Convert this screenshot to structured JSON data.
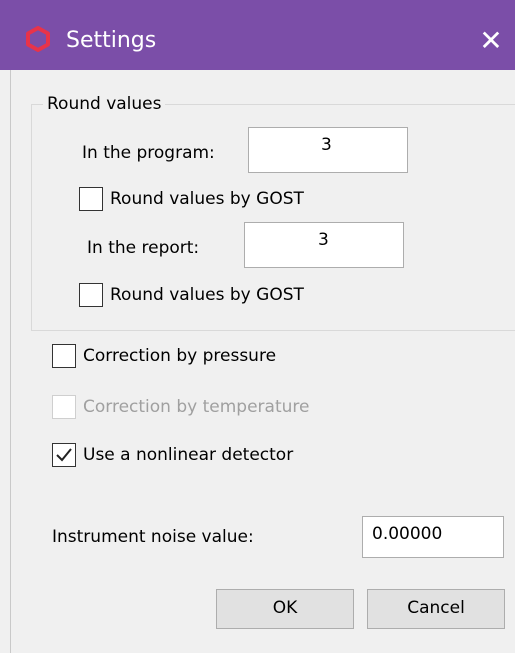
{
  "window": {
    "title": "Settings",
    "close_glyph": "✕"
  },
  "round_group": {
    "label": "Round values",
    "program": {
      "label": "In the program:",
      "value": "3",
      "gost_label": "Round values by GOST",
      "gost_checked": false
    },
    "report": {
      "label": "In the report:",
      "value": "3",
      "gost_label": "Round values by GOST",
      "gost_checked": false
    }
  },
  "options": {
    "pressure": {
      "label": "Correction by pressure",
      "checked": false,
      "enabled": true
    },
    "temperature": {
      "label": "Correction by temperature",
      "checked": false,
      "enabled": false
    },
    "nonlinear": {
      "label": "Use a nonlinear detector",
      "checked": true,
      "enabled": true
    }
  },
  "noise": {
    "label": "Instrument noise value:",
    "value": "0.00000"
  },
  "buttons": {
    "ok": "OK",
    "cancel": "Cancel"
  },
  "colors": {
    "titlebar": "#7b4ea8",
    "app_icon": "#e8334a",
    "disabled_text": "#a0a0a0"
  },
  "icons": {
    "app": "hexagon-icon",
    "close": "close-icon",
    "check": "checkmark-icon"
  }
}
